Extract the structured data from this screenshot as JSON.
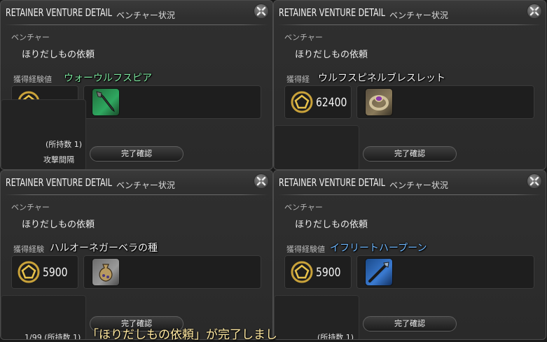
{
  "colors": {
    "item_name_green": "#7ee8a0",
    "item_name_white": "#f4f4f4",
    "item_name_blue": "#6fb8ff",
    "notice_text": "#ffe8a0"
  },
  "panels": [
    {
      "title": "RETAINER VENTURE DETAIL",
      "subtitle": "ベンチャー状況",
      "venture_label": "ベンチャー",
      "venture_type": "ほりだしもの依頼",
      "exp_label": "獲得経験値",
      "item_name": "ウォーウルフスピア",
      "exp_value": "",
      "item_icon": "spear-icon",
      "confirm_label": "完了確認",
      "owned_label": "(所持数 1)",
      "attack_interval_label": "攻撃間隔"
    },
    {
      "title": "RETAINER VENTURE DETAIL",
      "subtitle": "ベンチャー状況",
      "venture_label": "ベンチャー",
      "venture_type": "ほりだしもの依頼",
      "exp_label": "獲得経",
      "item_name": "ウルフスピネルブレスレット",
      "exp_value": "62400",
      "item_icon": "bracelet-icon",
      "confirm_label": "完了確認"
    },
    {
      "title": "RETAINER VENTURE DETAIL",
      "subtitle": "ベンチャー状況",
      "venture_label": "ベンチャー",
      "venture_type": "ほりだしもの依頼",
      "exp_label": "獲得経験",
      "item_name": "ハルオーネガーベラの種",
      "exp_value": "5900",
      "item_icon": "seed-bag-icon",
      "confirm_label": "完了確認",
      "owned_label": "1/99 (所持数 1)"
    },
    {
      "title": "RETAINER VENTURE DETAIL",
      "subtitle": "ベンチャー状況",
      "venture_label": "ベンチャー",
      "venture_type": "ほりだしもの依頼",
      "exp_label": "獲得経験値",
      "item_name": "イフリートハープーン",
      "exp_value": "5900",
      "item_icon": "harpoon-icon",
      "confirm_label": "完了確認",
      "owned_label": "(所持数 1)"
    }
  ],
  "notice": "「ほりだしもの依頼」が完了しまし"
}
